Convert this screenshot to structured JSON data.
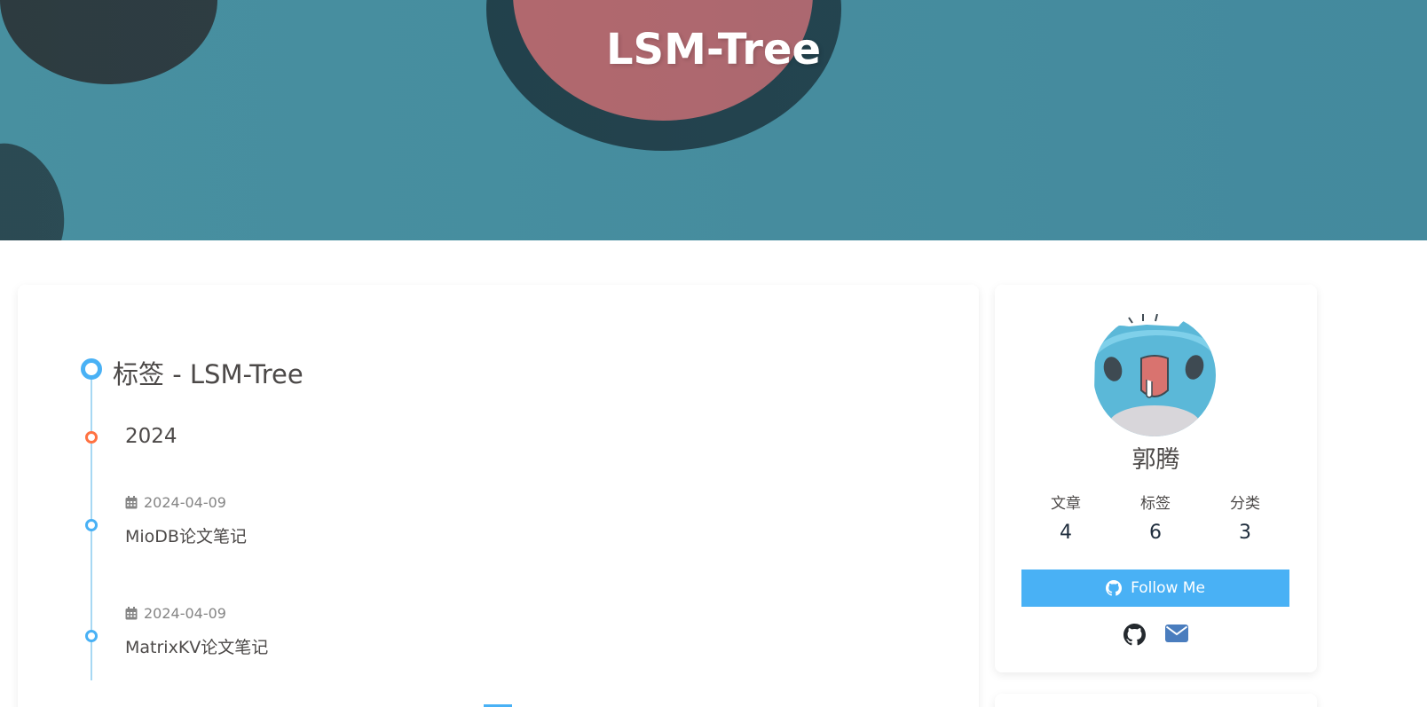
{
  "banner": {
    "title": "LSM-Tree"
  },
  "archive": {
    "heading": "标签 - LSM-Tree",
    "year": "2024",
    "items": [
      {
        "date": "2024-04-09",
        "title": "MioDB论文笔记"
      },
      {
        "date": "2024-04-09",
        "title": "MatrixKV论文笔记"
      }
    ]
  },
  "profile": {
    "name": "郭腾",
    "stats": [
      {
        "label": "文章",
        "value": "4"
      },
      {
        "label": "标签",
        "value": "6"
      },
      {
        "label": "分类",
        "value": "3"
      }
    ],
    "follow_label": "Follow Me",
    "social_icons": [
      "github-icon",
      "envelope-icon"
    ]
  },
  "colors": {
    "accent": "#49b1f5",
    "year_dot": "#ff7242",
    "banner_bg": "#4a93a3",
    "envelope": "#4a7dbe"
  }
}
